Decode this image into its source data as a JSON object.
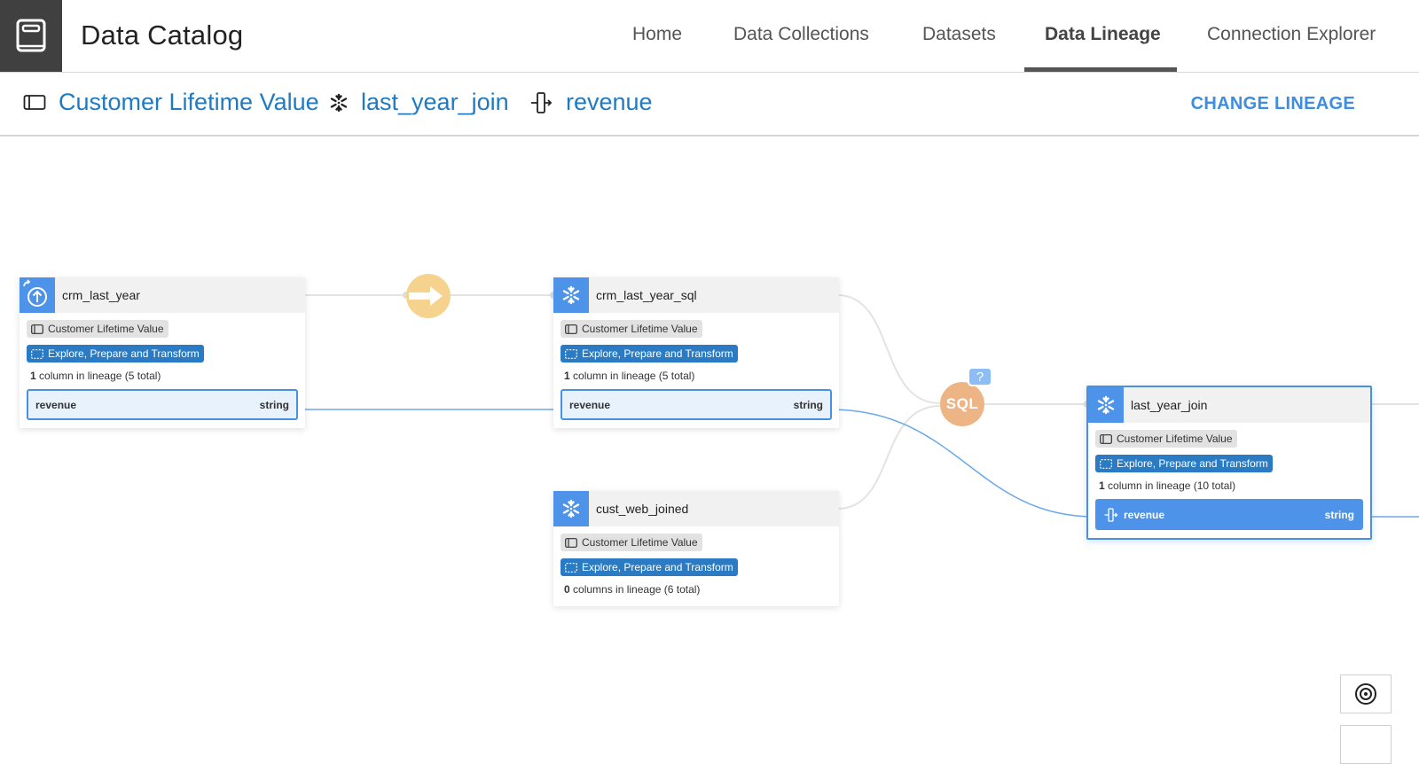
{
  "app": {
    "title": "Data Catalog",
    "logo_icon": "book-icon"
  },
  "nav": {
    "items": [
      {
        "label": "Home",
        "active": false
      },
      {
        "label": "Data Collections",
        "active": false
      },
      {
        "label": "Datasets",
        "active": false
      },
      {
        "label": "Data Lineage",
        "active": true
      },
      {
        "label": "Connection Explorer",
        "active": false
      }
    ]
  },
  "breadcrumb": {
    "items": [
      {
        "label": "Customer Lifetime Value",
        "icon": "collection-icon"
      },
      {
        "label": "last_year_join",
        "icon": "snowflake-icon"
      },
      {
        "label": "revenue",
        "icon": "column-icon"
      }
    ],
    "action_label": "CHANGE LINEAGE"
  },
  "colors": {
    "accent": "#1f7ac1",
    "node_icon_bg": "#4e93ea",
    "tag_blue": "#2a7bc3",
    "transform_upload": "#f5d38f",
    "transform_sql": "#edb585",
    "question_badge": "#8dbdf5",
    "lineage_edge": "#6aa8ea"
  },
  "lineage": {
    "nodes": [
      {
        "id": "crm_last_year",
        "name": "crm_last_year",
        "icon": "upload-icon",
        "collection_tag": "Customer Lifetime Value",
        "project_tag": "Explore, Prepare and Transform",
        "count_num": "1",
        "count_text": " column in lineage (5 total)",
        "column": {
          "name": "revenue",
          "type": "string",
          "highlighted": false
        }
      },
      {
        "id": "crm_last_year_sql",
        "name": "crm_last_year_sql",
        "icon": "snowflake-icon",
        "collection_tag": "Customer Lifetime Value",
        "project_tag": "Explore, Prepare and Transform",
        "count_num": "1",
        "count_text": " column in lineage (5 total)",
        "column": {
          "name": "revenue",
          "type": "string",
          "highlighted": false
        }
      },
      {
        "id": "cust_web_joined",
        "name": "cust_web_joined",
        "icon": "snowflake-icon",
        "collection_tag": "Customer Lifetime Value",
        "project_tag": "Explore, Prepare and Transform",
        "count_num": "0",
        "count_text": " columns in lineage (6 total)",
        "column": null
      },
      {
        "id": "last_year_join",
        "name": "last_year_join",
        "icon": "snowflake-icon",
        "selected": true,
        "collection_tag": "Customer Lifetime Value",
        "project_tag": "Explore, Prepare and Transform",
        "count_num": "1",
        "count_text": " column in lineage (10 total)",
        "column": {
          "name": "revenue",
          "type": "string",
          "highlighted": true
        }
      }
    ],
    "transforms": [
      {
        "id": "push",
        "label": "",
        "icon": "arrow-right-icon"
      },
      {
        "id": "sql",
        "label": "SQL",
        "badge": "?"
      }
    ]
  },
  "controls": {
    "recenter_icon": "target-icon"
  }
}
